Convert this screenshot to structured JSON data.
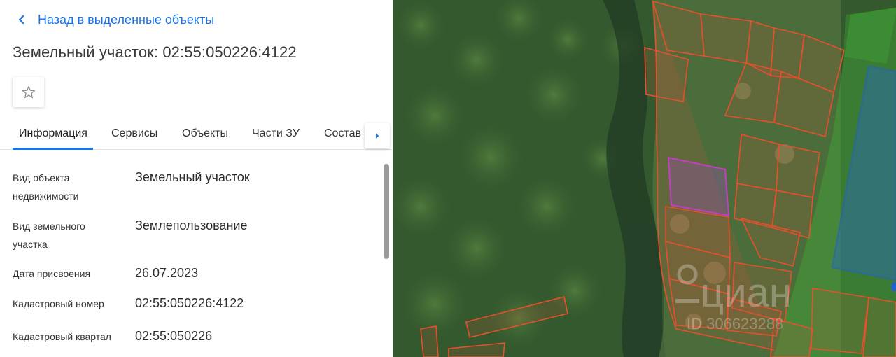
{
  "nav": {
    "back_label": "Назад в выделенные объекты"
  },
  "header": {
    "title": "Земельный участок: 02:55:050226:4122"
  },
  "tabs": [
    {
      "label": "Информация",
      "active": true
    },
    {
      "label": "Сервисы"
    },
    {
      "label": "Объекты"
    },
    {
      "label": "Части ЗУ"
    },
    {
      "label": "Состав"
    }
  ],
  "info": [
    {
      "label": "Вид объекта недвижимости",
      "value": "Земельный участок"
    },
    {
      "label": "Вид земельного участка",
      "value": "Землепользование"
    },
    {
      "label": "Дата присвоения",
      "value": "26.07.2023"
    },
    {
      "label": "Кадастровый номер",
      "value": "02:55:050226:4122"
    },
    {
      "label": "Кадастровый квартал",
      "value": "02:55:050226"
    }
  ],
  "map": {
    "watermark": "циан",
    "watermark_id": "ID 306623288",
    "colors": {
      "parcel_outline": "#e8502d",
      "selected_parcel": "#c23fc2",
      "zone_green": "#3fae2a",
      "zone_blue": "#1f5fd6"
    }
  },
  "colors": {
    "accent": "#1a73e8"
  },
  "icons": {
    "back": "chevron-left-icon",
    "favorite": "star-outline-icon",
    "tabs_next": "caret-right-icon"
  }
}
